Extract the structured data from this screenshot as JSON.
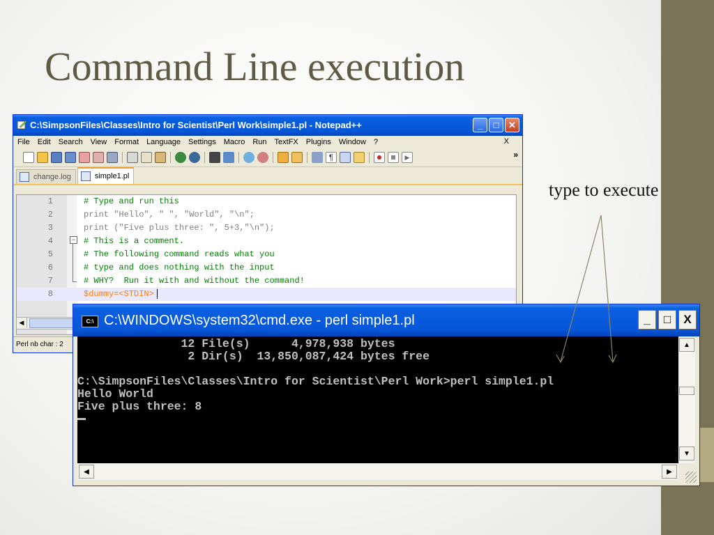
{
  "slide": {
    "title": "Command Line execution",
    "annotation": "type to execute",
    "colors": {
      "title": "#5f5a44",
      "side_band": "#7b7358",
      "accent": "#b4aa82"
    }
  },
  "notepad": {
    "title": "C:\\SimpsonFiles\\Classes\\Intro for Scientist\\Perl Work\\simple1.pl - Notepad++",
    "menu": [
      "File",
      "Edit",
      "Search",
      "View",
      "Format",
      "Language",
      "Settings",
      "Macro",
      "Run",
      "TextFX",
      "Plugins",
      "Window",
      "?"
    ],
    "menu_close": "X",
    "toolbar_more": "»",
    "tabs": [
      {
        "label": "change.log",
        "active": false
      },
      {
        "label": "simple1.pl",
        "active": true
      }
    ],
    "code_lines": [
      {
        "num": "1",
        "text": "# Type and run this"
      },
      {
        "num": "2",
        "text": "print \"Hello\", \" \", \"World\", \"\\n\";"
      },
      {
        "num": "3",
        "text": "print (\"Five plus three: \", 5+3,\"\\n\");"
      },
      {
        "num": "4",
        "text": "# This is a comment."
      },
      {
        "num": "5",
        "text": "# The following command reads what you"
      },
      {
        "num": "6",
        "text": "# type and does nothing with the input"
      },
      {
        "num": "7",
        "text": "# WHY?  Run it with and without the command!"
      },
      {
        "num": "8",
        "text": "$dummy=<STDIN>"
      }
    ],
    "status": "Perl nb char : 2"
  },
  "cmd": {
    "title": "C:\\WINDOWS\\system32\\cmd.exe - perl simple1.pl",
    "icon_label": "C:\\",
    "buttons": {
      "minimize": "_",
      "maximize": "□",
      "close": "X"
    },
    "lines": [
      "               12 File(s)      4,978,938 bytes",
      "                2 Dir(s)  13,850,087,424 bytes free",
      "",
      "C:\\SimpsonFiles\\Classes\\Intro for Scientist\\Perl Work>perl simple1.pl",
      "Hello World",
      "Five plus three: 8"
    ]
  }
}
